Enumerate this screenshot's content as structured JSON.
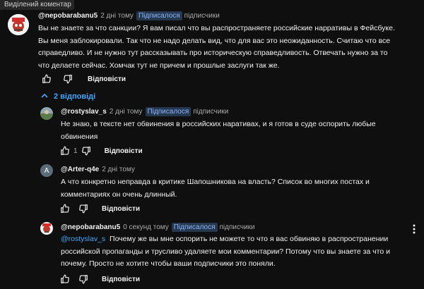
{
  "banner": {
    "label": "Виділений коментар"
  },
  "comments": [
    {
      "author": "@nepobarabanu5",
      "time": "2 дні тому",
      "badge": "Підписалося",
      "sub": "підписчики",
      "lines": [
        "Вы не знаете за что санкции? Я вам писал что вы распространяете российские нарративы в Фейсбуке.",
        "Вы меня заблокировали. Так что не надо делать вид, что для вас это неожиданность. Считаю что все",
        "справедливо. И не нужно тут рассказывать про историческую справедливость. Отвечать нужно за то",
        "что делаете сейчас. Хомчак тут не причем и прошлые заслуги так же."
      ],
      "reply_label": "Відповісти",
      "like_count": ""
    }
  ],
  "replies_toggle": {
    "label": "2 відповіді"
  },
  "replies": [
    {
      "author": "@rostyslav_s",
      "time": "2 дні тому",
      "badge": "Підписалося",
      "sub": "підписчики",
      "lines": [
        "Не знаю, в тексте нет обвинения в российских наративах, и я готов в суде оспорить любые",
        "обвинения"
      ],
      "like_count": "1",
      "reply_label": "Відповісти"
    },
    {
      "author": "@Arter-q4e",
      "time": "2 дні тому",
      "avatar_letter": "A",
      "lines": [
        "А что конкретно неправда в критике Шапошникова на власть? Список во многих постах и",
        "комментариях он  очень длинный."
      ],
      "like_count": "",
      "reply_label": "Відповісти"
    },
    {
      "author": "@nepobarabanu5",
      "time": "0 секунд тому",
      "badge": "Підписалося",
      "sub": "підписчики",
      "mention": "@rostyslav_s",
      "line1_rest": "  Почему же вы мне оспорить не можете то что я вас обвиняю в распространении",
      "lines": [
        "российской пропаганды и трусливо удаляете мои комментарии? Потому что вы знаете за что и",
        "почему. Просто не хотите чтобы ваши подписчики это поняли."
      ],
      "like_count": "",
      "reply_label": "Відповісти"
    }
  ],
  "icons": {
    "like": "thumb-up-icon",
    "dislike": "thumb-down-icon",
    "more": "more-vert-icon",
    "chevron": "chevron-up-icon"
  },
  "colors": {
    "accent": "#3ea6ff",
    "badge_bg": "#263850",
    "badge_text": "#8ab4f8",
    "bg": "#0f0f0f"
  }
}
